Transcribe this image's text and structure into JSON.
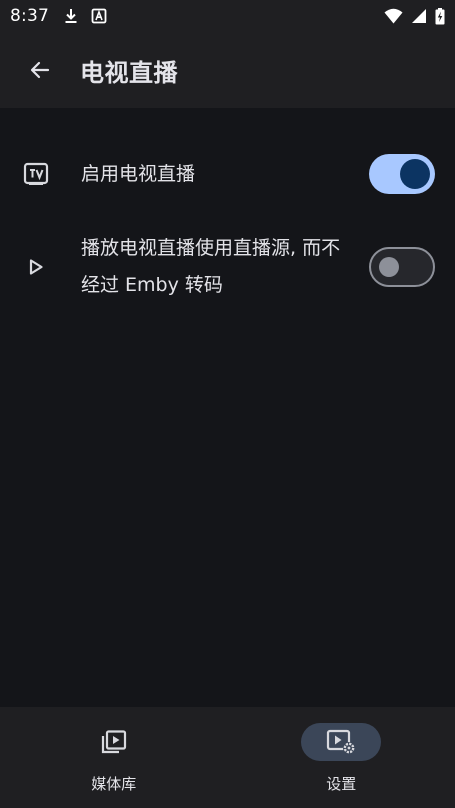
{
  "status_bar": {
    "time": "8:37",
    "left_icons": [
      "download-icon",
      "app-notification-icon"
    ],
    "right_icons": [
      "wifi-icon",
      "signal-icon",
      "battery-charging-icon"
    ]
  },
  "app_bar": {
    "back_icon": "arrow-back-icon",
    "title": "电视直播"
  },
  "settings": [
    {
      "icon": "tv-icon",
      "label": "启用电视直播",
      "enabled": true
    },
    {
      "icon": "play-icon",
      "label": "播放电视直播使用直播源, 而不经过 Emby 转码",
      "enabled": false
    }
  ],
  "bottom_nav": {
    "items": [
      {
        "icon": "media-library-icon",
        "label": "媒体库",
        "active": false
      },
      {
        "icon": "settings-video-icon",
        "label": "设置",
        "active": true
      }
    ]
  },
  "colors": {
    "background": "#141519",
    "surface": "#1f1f22",
    "switch_on_track": "#a8c8ff",
    "switch_on_knob": "#0c3462",
    "switch_off_outline": "#8d9099",
    "nav_active_pill": "#3b4658"
  }
}
